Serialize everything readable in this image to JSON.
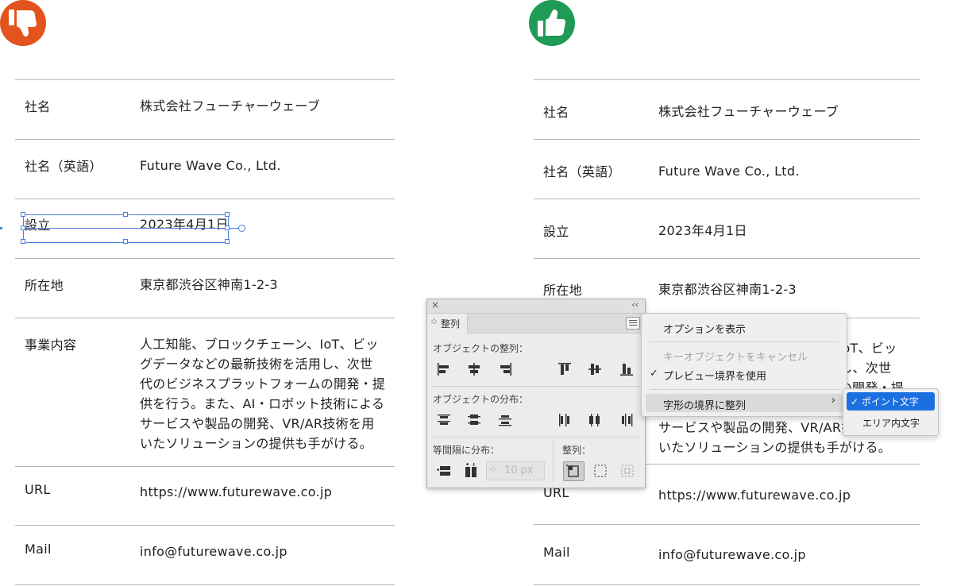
{
  "rows": [
    {
      "label": "社名",
      "value": "株式会社フューチャーウェーブ"
    },
    {
      "label": "社名（英語）",
      "value": "Future Wave Co., Ltd."
    },
    {
      "label": "設立",
      "value": "2023年4月1日"
    },
    {
      "label": "所在地",
      "value": "東京都渋谷区神南1-2-3"
    },
    {
      "label": "事業内容",
      "value": "人工知能、ブロックチェーン、IoT、ビッ\nグデータなどの最新技術を活用し、次世\n代のビジネスプラットフォームの開発・提\n供を行う。また、AI・ロボット技術による\nサービスや製品の開発、VR/AR技術を用\nいたソリューションの提供も手がける。"
    },
    {
      "label": "URL",
      "value": "https://www.futurewave.co.jp"
    },
    {
      "label": "Mail",
      "value": "info@futurewave.co.jp"
    }
  ],
  "icons": {
    "bad": "thumbs-down-icon",
    "good": "thumbs-up-icon"
  },
  "colors": {
    "bad": "#e2531d",
    "good": "#1f9b57",
    "selection": "#4a7fe0",
    "menu_highlight": "#1c6fe0"
  },
  "align_panel": {
    "close": "×",
    "collapse": "‹‹",
    "tab_icon": "◇",
    "tab_label": "整列",
    "align_objects": "オブジェクトの整列：",
    "distribute_objects": "オブジェクトの分布：",
    "distribute_spacing": "等間隔に分布：",
    "align_to": "整列：",
    "spacing_arrows": "︿\n﹀",
    "spacing_value": "10 px"
  },
  "flyout_menu": {
    "items": [
      {
        "label": "オプションを表示",
        "enabled": true
      },
      {
        "label": "キーオブジェクトをキャンセル",
        "enabled": false
      },
      {
        "label": "プレビュー境界を使用",
        "enabled": true,
        "checked": true
      },
      {
        "label": "字形の境界に整列",
        "enabled": true,
        "submenu": true
      }
    ],
    "check": "✓",
    "chevron": "›"
  },
  "submenu": {
    "items": [
      {
        "label": "✓ ポイント文字",
        "selected": true
      },
      {
        "label": "エリア内文字",
        "selected": false
      }
    ]
  }
}
